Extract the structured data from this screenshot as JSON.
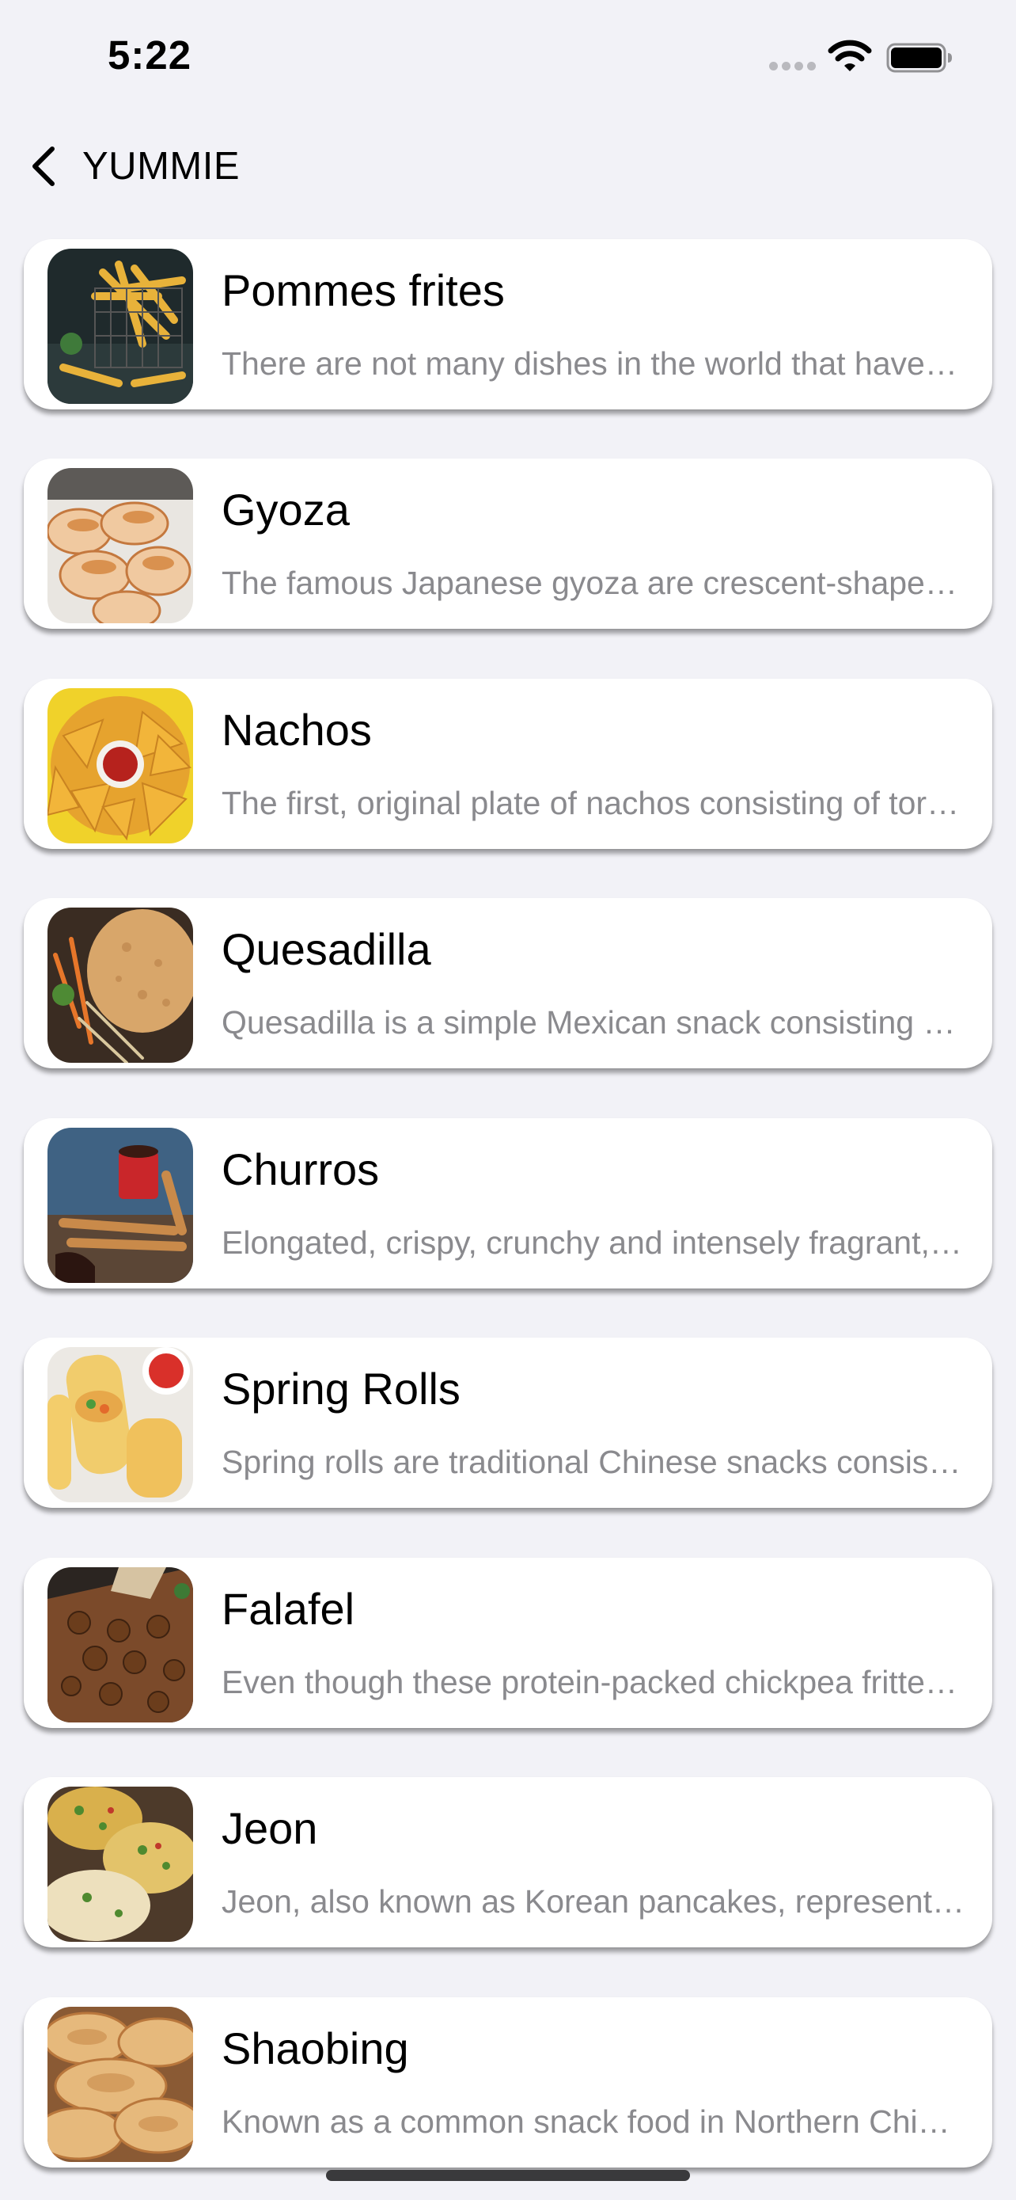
{
  "status_bar": {
    "time": "5:22",
    "icons": [
      "signal-icon",
      "wifi-icon",
      "battery-icon"
    ]
  },
  "nav": {
    "back_label": "YUMMIE",
    "back_icon": "chevron-left-icon"
  },
  "dishes": [
    {
      "name": "Pommes frites",
      "description": "There are not many dishes in the world that have recognition as an iconic snack food like french fries.",
      "image": "fries-photo"
    },
    {
      "name": "Gyoza",
      "description": "The famous Japanese gyoza are crescent-shaped dumplings filled with meat and vegetables.",
      "image": "gyoza-photo"
    },
    {
      "name": "Nachos",
      "description": "The first, original plate of nachos consisting of tortilla chips, cheese and jalapenos.",
      "image": "nachos-photo"
    },
    {
      "name": "Quesadilla",
      "description": "Quesadilla is a simple Mexican snack consisting of a tortilla filled with cheese.",
      "image": "quesadilla-photo"
    },
    {
      "name": "Churros",
      "description": "Elongated, crispy, crunchy and intensely fragrant, churros are a fried dough snack.",
      "image": "churros-photo"
    },
    {
      "name": "Spring Rolls",
      "description": "Spring rolls are traditional Chinese snacks consisting of thin wrappers filled with vegetables.",
      "image": "spring-rolls-photo"
    },
    {
      "name": "Falafel",
      "description": "Even though these protein-packed chickpea fritters are eaten throughout the Middle East.",
      "image": "falafel-photo"
    },
    {
      "name": "Jeon",
      "description": "Jeon, also known as Korean pancakes, represents a variety of battered and fried dishes.",
      "image": "jeon-photo"
    },
    {
      "name": "Shaobing",
      "description": "Known as a common snack food in Northern China, shaobing is a baked layered flatbread.",
      "image": "shaobing-photo"
    }
  ],
  "colors": {
    "background": "#f2f2f7",
    "card": "#ffffff",
    "secondary_text": "#8a8a8e"
  }
}
